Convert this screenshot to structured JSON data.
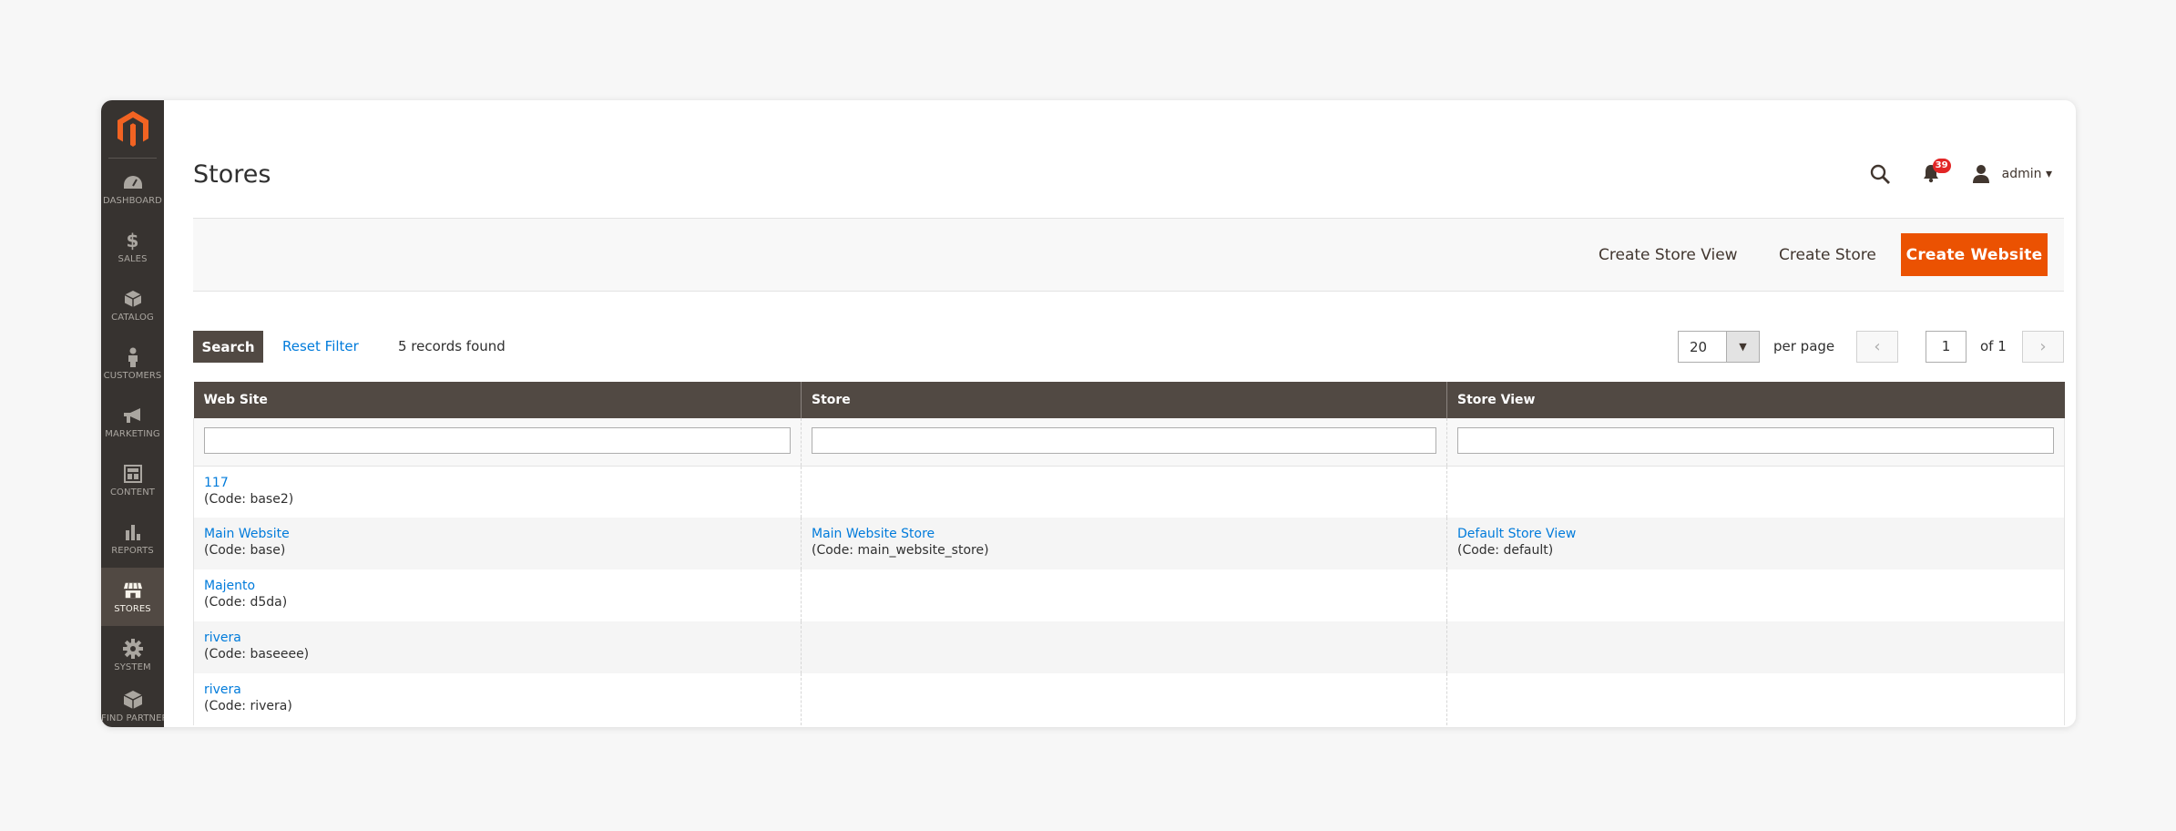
{
  "sidebar": {
    "items": [
      {
        "label": "DASHBOARD",
        "icon": "dashboard-icon"
      },
      {
        "label": "SALES",
        "icon": "dollar-icon"
      },
      {
        "label": "CATALOG",
        "icon": "box-icon"
      },
      {
        "label": "CUSTOMERS",
        "icon": "person-icon"
      },
      {
        "label": "MARKETING",
        "icon": "megaphone-icon"
      },
      {
        "label": "CONTENT",
        "icon": "layout-icon"
      },
      {
        "label": "REPORTS",
        "icon": "bar-chart-icon"
      },
      {
        "label": "STORES",
        "icon": "storefront-icon"
      },
      {
        "label": "SYSTEM",
        "icon": "gear-icon"
      },
      {
        "label": "FIND PARTNERS & EXTENSIONS",
        "icon": "cube-icon"
      }
    ],
    "active": "STORES"
  },
  "header": {
    "title": "Stores",
    "notification_count": "39",
    "user": "admin ▾"
  },
  "actions": {
    "create_store_view": "Create Store View",
    "create_store": "Create Store",
    "create_website": "Create Website"
  },
  "toolbar": {
    "search": "Search",
    "reset_filter": "Reset Filter",
    "records_found": "5 records found",
    "per_page_value": "20",
    "per_page_label": "per page",
    "page": "1",
    "of_pages": "of 1"
  },
  "grid": {
    "columns": [
      "Web Site",
      "Store",
      "Store View"
    ],
    "rows": [
      {
        "website": "117",
        "website_code": "(Code: base2)",
        "store": "",
        "store_code": "",
        "view": "",
        "view_code": ""
      },
      {
        "website": "Main Website",
        "website_code": "(Code: base)",
        "store": "Main Website Store",
        "store_code": "(Code: main_website_store)",
        "view": "Default Store View",
        "view_code": "(Code: default)"
      },
      {
        "website": "Majento",
        "website_code": "(Code: d5da)",
        "store": "",
        "store_code": "",
        "view": "",
        "view_code": ""
      },
      {
        "website": "rivera",
        "website_code": "(Code: baseeee)",
        "store": "",
        "store_code": "",
        "view": "",
        "view_code": ""
      },
      {
        "website": "rivera",
        "website_code": "(Code: rivera)",
        "store": "",
        "store_code": "",
        "view": "",
        "view_code": ""
      }
    ]
  },
  "colors": {
    "sidebar_bg": "#373330",
    "accent": "#eb5202",
    "link": "#007bdb",
    "header_bg": "#514943"
  }
}
